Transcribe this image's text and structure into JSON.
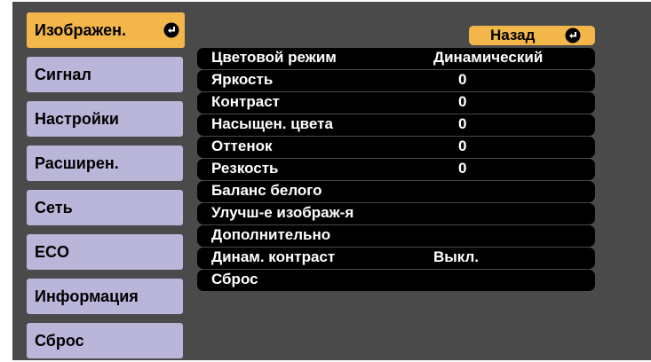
{
  "colors": {
    "screen_bg": "#4a4a4a",
    "tab_bg": "#b9b6d9",
    "tab_active_bg": "#f2b64a",
    "row_bg": "#000000",
    "text_light": "#ffffff"
  },
  "tabs": [
    {
      "label": "Изображен.",
      "active": true,
      "icon": "enter-icon"
    },
    {
      "label": "Сигнал"
    },
    {
      "label": "Настройки"
    },
    {
      "label": "Расширен."
    },
    {
      "label": "Сеть"
    },
    {
      "label": "ECO"
    },
    {
      "label": "Информация"
    },
    {
      "label": "Сброс"
    }
  ],
  "back_button": {
    "label": "Назад",
    "icon": "enter-icon"
  },
  "settings": [
    {
      "label": "Цветовой режим",
      "value": "Динамический"
    },
    {
      "label": "Яркость",
      "value": "0"
    },
    {
      "label": "Контраст",
      "value": "0"
    },
    {
      "label": "Насыщен. цвета",
      "value": "0"
    },
    {
      "label": "Оттенок",
      "value": "0"
    },
    {
      "label": "Резкость",
      "value": "0"
    },
    {
      "label": "Баланс белого",
      "value": ""
    },
    {
      "label": "Улучш-е изображ-я",
      "value": ""
    },
    {
      "label": "Дополнительно",
      "value": ""
    },
    {
      "label": "Динам. контраст",
      "value": "Выкл."
    },
    {
      "label": "Сброс",
      "value": ""
    }
  ]
}
